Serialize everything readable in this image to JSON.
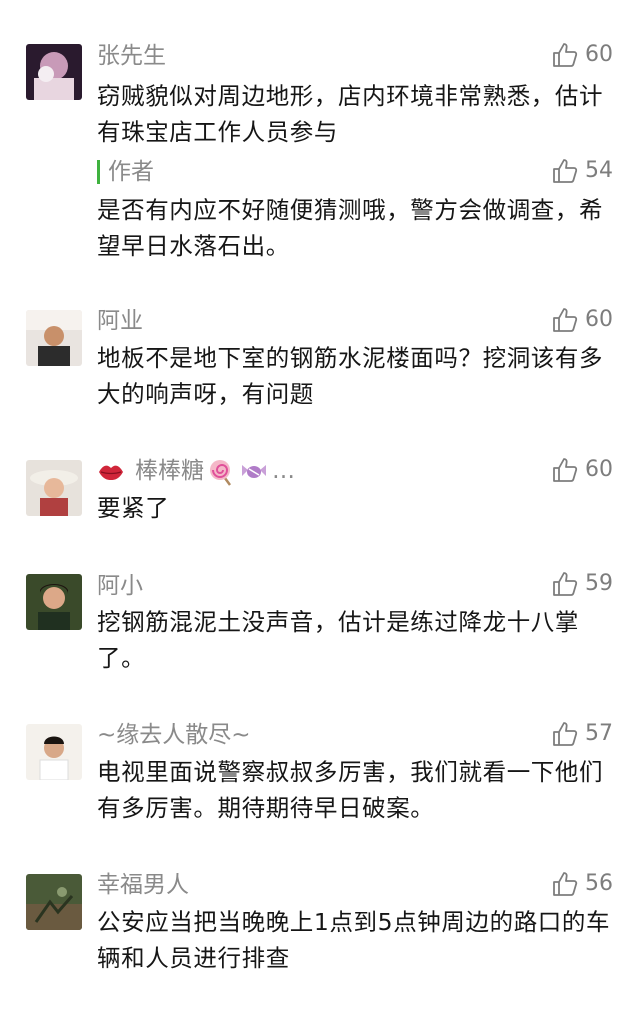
{
  "comments": [
    {
      "user": "张先生",
      "likes": "60",
      "text": "窃贼貌似对周边地形，店内环境非常熟悉，估计有珠宝店工作人员参与",
      "reply": {
        "user": "作者",
        "likes": "54",
        "text": "是否有内应不好随便猜测哦，警方会做调查，希望早日水落石出。"
      }
    },
    {
      "user": "阿业",
      "likes": "60",
      "text": "地板不是地下室的钢筋水泥楼面吗？挖洞该有多大的响声呀，有问题"
    },
    {
      "user": "棒棒糖",
      "suffix": "…",
      "likes": "60",
      "text": "要紧了"
    },
    {
      "user": "阿小",
      "likes": "59",
      "text": "挖钢筋混泥土没声音，估计是练过降龙十八掌了。"
    },
    {
      "user": "~缘去人散尽~",
      "likes": "57",
      "text": "电视里面说警察叔叔多厉害，我们就看一下他们有多厉害。期待期待早日破案。"
    },
    {
      "user": "幸福男人",
      "likes": "56",
      "text": "公安应当把当晚晚上1点到5点钟周边的路口的车辆和人员进行排查"
    }
  ],
  "icons": {
    "like": "thumbs-up-icon"
  },
  "colors": {
    "name": "#8a8a8a",
    "text": "#161616",
    "author_bar": "#3fb23f"
  }
}
